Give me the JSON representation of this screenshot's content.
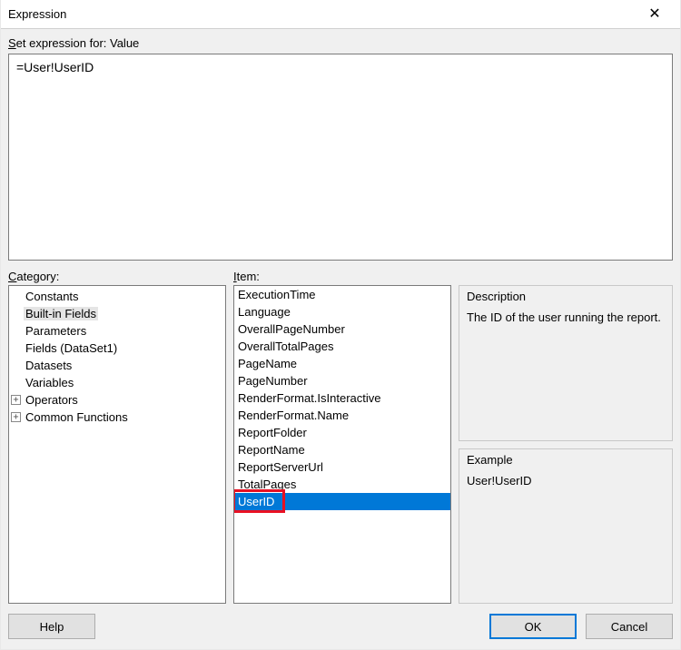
{
  "window": {
    "title": "Expression",
    "close_glyph": "✕"
  },
  "set_for_prefix": "S",
  "set_for_rest": "et expression for: ",
  "set_for_target": "Value",
  "expression_value": "=User!UserID",
  "labels": {
    "category_u": "C",
    "category_rest": "ategory:",
    "item_u": "I",
    "item_rest": "tem:",
    "help": "Help",
    "ok": "OK",
    "cancel": "Cancel"
  },
  "category_tree": [
    {
      "label": "Constants",
      "expandable": false,
      "indent": 1,
      "selected": false
    },
    {
      "label": "Built-in Fields",
      "expandable": false,
      "indent": 1,
      "selected": true
    },
    {
      "label": "Parameters",
      "expandable": false,
      "indent": 1,
      "selected": false
    },
    {
      "label": "Fields (DataSet1)",
      "expandable": false,
      "indent": 1,
      "selected": false
    },
    {
      "label": "Datasets",
      "expandable": false,
      "indent": 1,
      "selected": false
    },
    {
      "label": "Variables",
      "expandable": false,
      "indent": 1,
      "selected": false
    },
    {
      "label": "Operators",
      "expandable": true,
      "indent": 0,
      "selected": false
    },
    {
      "label": "Common Functions",
      "expandable": true,
      "indent": 0,
      "selected": false
    }
  ],
  "items": [
    {
      "label": "ExecutionTime",
      "selected": false
    },
    {
      "label": "Language",
      "selected": false
    },
    {
      "label": "OverallPageNumber",
      "selected": false
    },
    {
      "label": "OverallTotalPages",
      "selected": false
    },
    {
      "label": "PageName",
      "selected": false
    },
    {
      "label": "PageNumber",
      "selected": false
    },
    {
      "label": "RenderFormat.IsInteractive",
      "selected": false
    },
    {
      "label": "RenderFormat.Name",
      "selected": false
    },
    {
      "label": "ReportFolder",
      "selected": false
    },
    {
      "label": "ReportName",
      "selected": false
    },
    {
      "label": "ReportServerUrl",
      "selected": false
    },
    {
      "label": "TotalPages",
      "selected": false
    },
    {
      "label": "UserID",
      "selected": true
    }
  ],
  "description": {
    "title": "Description",
    "text": "The ID of the user running the report."
  },
  "example": {
    "title": "Example",
    "text": "User!UserID"
  }
}
